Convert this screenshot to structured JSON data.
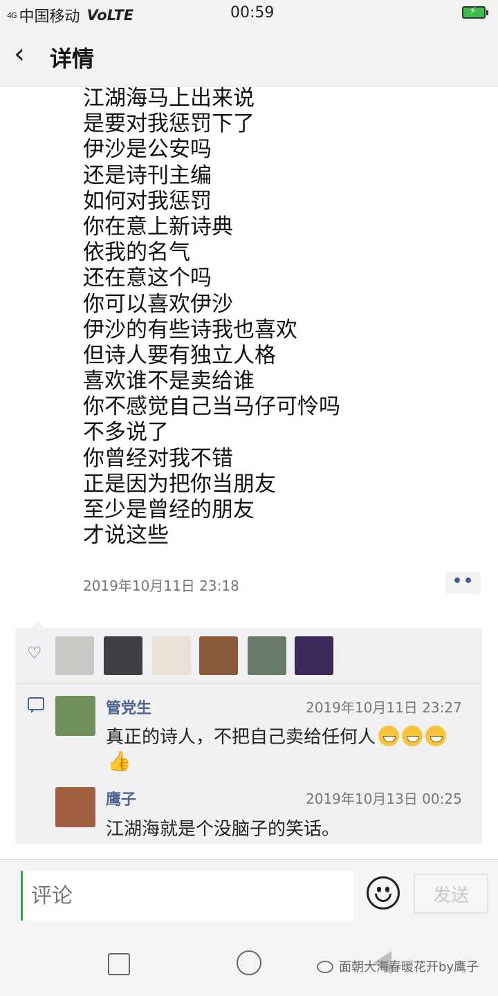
{
  "status_bar": {
    "signal": "4G",
    "carrier": "中国移动",
    "network": "VoLTE",
    "time": "00:59"
  },
  "header": {
    "back_icon": "chevron-left-icon",
    "title": "详情"
  },
  "post": {
    "lines": [
      "江湖海马上出来说",
      "是要对我惩罚下了",
      "伊沙是公安吗",
      "还是诗刊主编",
      "如何对我惩罚",
      "你在意上新诗典",
      "依我的名气",
      "还在意这个吗",
      "你可以喜欢伊沙",
      "伊沙的有些诗我也喜欢",
      "但诗人要有独立人格",
      "喜欢谁不是卖给谁",
      "你不感觉自己当马仔可怜吗",
      "不多说了",
      "你曾经对我不错",
      "正是因为把你当朋友",
      "至少是曾经的朋友",
      "才说这些"
    ],
    "timestamp": "2019年10月11日 23:18",
    "more_label": "••"
  },
  "likes": {
    "icon": "heart-icon",
    "avatar_colors": [
      "#c9c9c4",
      "#3d3d42",
      "#e8e2d6",
      "#8a5a3a",
      "#6a7a6a",
      "#3a2a5a"
    ]
  },
  "comments": [
    {
      "name": "管党生",
      "time": "2019年10月11日 23:27",
      "text": "真正的诗人，不把自己卖给任何人",
      "avatar_color": "#6e8f5a"
    },
    {
      "name": "鹰子",
      "time": "2019年10月13日 00:25",
      "text": "江湖海就是个没脑子的笑话。",
      "avatar_color": "#a06040"
    }
  ],
  "input_bar": {
    "placeholder": "评论",
    "send_label": "发送"
  },
  "watermark": "面朝大海春暖花开by鹰子",
  "colors": {
    "link_blue": "#4c6393",
    "timestamp_gray": "#777777",
    "comment_bg": "#f1f1f3"
  }
}
